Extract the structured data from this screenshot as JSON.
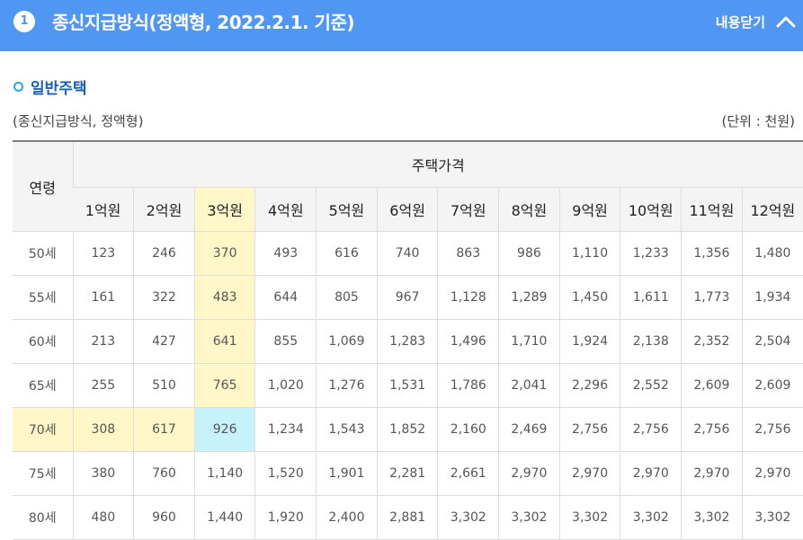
{
  "header": {
    "badge": "1",
    "title": "종신지급방식(정액형, 2022.2.1. 기준)",
    "toggle_label": "내용닫기",
    "toggle_icon": "chevron-up-icon"
  },
  "section": {
    "title": "일반주택",
    "caption_left": "(종신지급방식, 정액형)",
    "caption_right": "(단위 : 천원)"
  },
  "colors": {
    "header_bg": "#4f97f3",
    "highlight": "#fff7c7",
    "highlight_cross": "#c8f2fb",
    "section_title": "#1a5fb4"
  },
  "table": {
    "age_header": "연령",
    "price_header": "주택가격",
    "columns": [
      "1억원",
      "2억원",
      "3억원",
      "4억원",
      "5억원",
      "6억원",
      "7억원",
      "8억원",
      "9억원",
      "10억원",
      "11억원",
      "12억원"
    ],
    "highlight_column": "3억원",
    "highlight_row": "70세",
    "rows": [
      {
        "age": "50세",
        "values": [
          "123",
          "246",
          "370",
          "493",
          "616",
          "740",
          "863",
          "986",
          "1,110",
          "1,233",
          "1,356",
          "1,480"
        ]
      },
      {
        "age": "55세",
        "values": [
          "161",
          "322",
          "483",
          "644",
          "805",
          "967",
          "1,128",
          "1,289",
          "1,450",
          "1,611",
          "1,773",
          "1,934"
        ]
      },
      {
        "age": "60세",
        "values": [
          "213",
          "427",
          "641",
          "855",
          "1,069",
          "1,283",
          "1,496",
          "1,710",
          "1,924",
          "2,138",
          "2,352",
          "2,504"
        ]
      },
      {
        "age": "65세",
        "values": [
          "255",
          "510",
          "765",
          "1,020",
          "1,276",
          "1,531",
          "1,786",
          "2,041",
          "2,296",
          "2,552",
          "2,609",
          "2,609"
        ]
      },
      {
        "age": "70세",
        "values": [
          "308",
          "617",
          "926",
          "1,234",
          "1,543",
          "1,852",
          "2,160",
          "2,469",
          "2,756",
          "2,756",
          "2,756",
          "2,756"
        ]
      },
      {
        "age": "75세",
        "values": [
          "380",
          "760",
          "1,140",
          "1,520",
          "1,901",
          "2,281",
          "2,661",
          "2,970",
          "2,970",
          "2,970",
          "2,970",
          "2,970"
        ]
      },
      {
        "age": "80세",
        "values": [
          "480",
          "960",
          "1,440",
          "1,920",
          "2,400",
          "2,881",
          "3,302",
          "3,302",
          "3,302",
          "3,302",
          "3,302",
          "3,302"
        ]
      }
    ]
  }
}
